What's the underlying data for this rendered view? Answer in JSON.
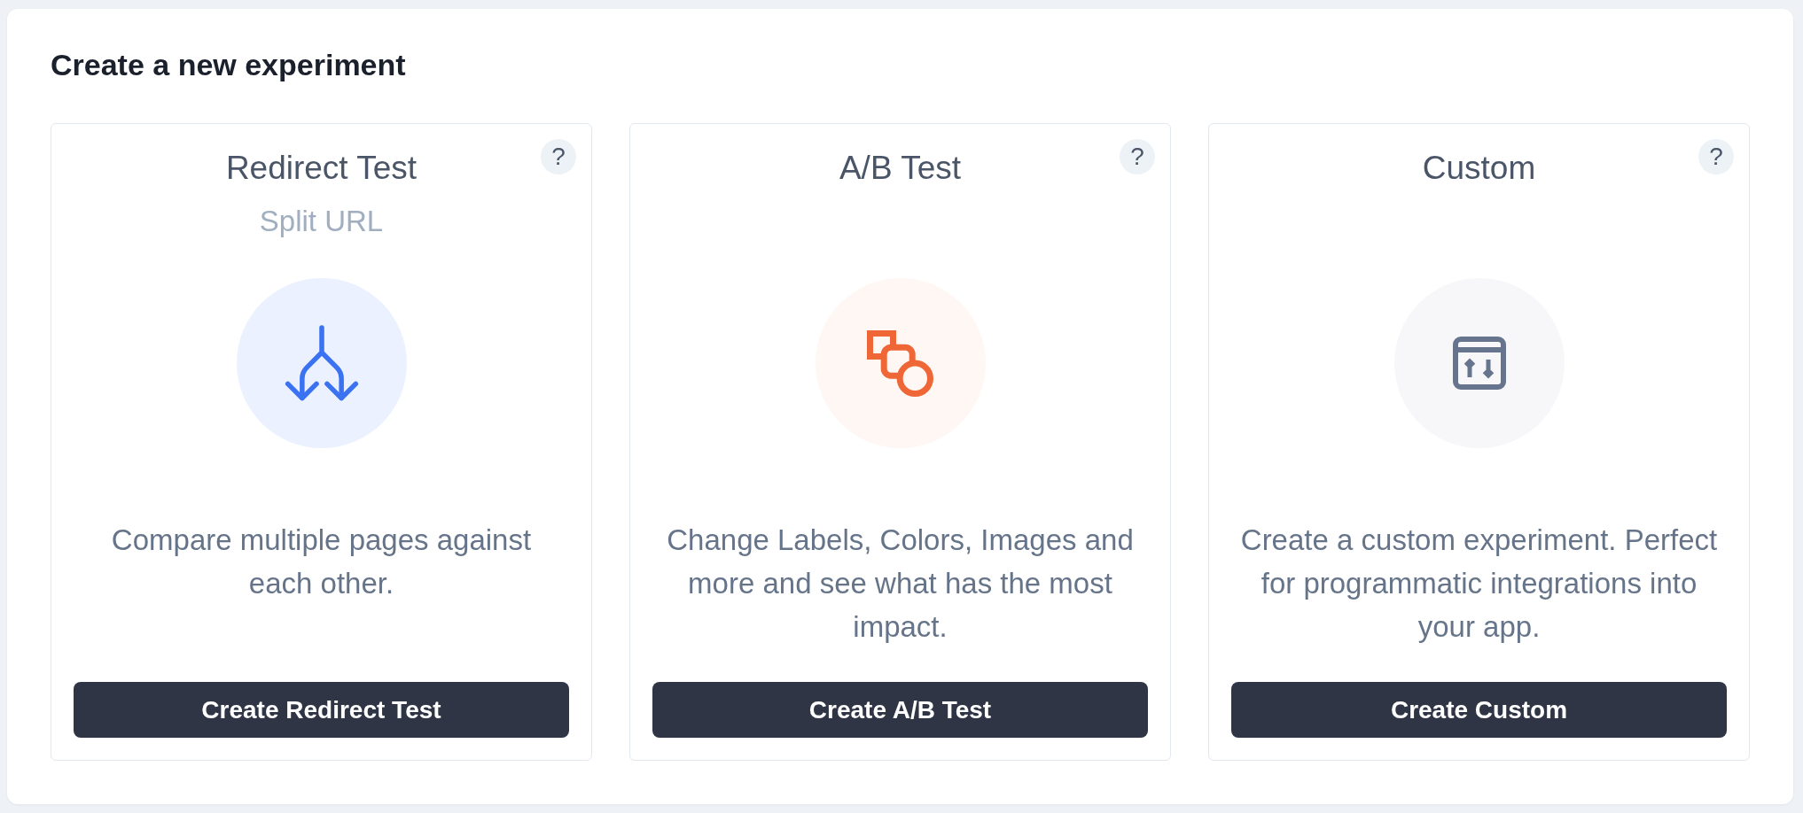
{
  "title": "Create a new experiment",
  "cards": [
    {
      "kind": "redirect",
      "title": "Redirect Test",
      "subtitle": "Split URL",
      "help": "?",
      "color": "#3b72f2",
      "description": "Compare multiple pages against each other.",
      "button": "Create Redirect Test"
    },
    {
      "kind": "ab",
      "title": "A/B Test",
      "help": "?",
      "color": "#ef6637",
      "description": "Change Labels, Colors, Images and more and see what has the most impact.",
      "button": "Create A/B Test"
    },
    {
      "kind": "custom",
      "title": "Custom",
      "help": "?",
      "color": "#66758d",
      "description": "Create a custom experiment. Perfect for programmatic integrations into your app.",
      "button": "Create Custom"
    }
  ]
}
